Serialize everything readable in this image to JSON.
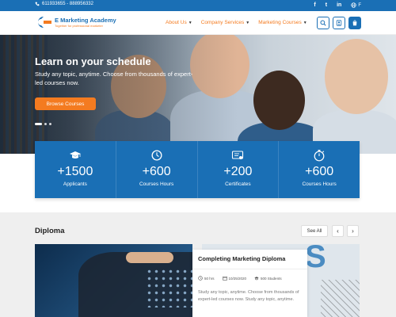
{
  "topbar": {
    "phone": "611933655 - 888956332",
    "socials": [
      {
        "icon": "facebook-icon",
        "glyph": "f"
      },
      {
        "icon": "twitter-icon",
        "glyph": "t"
      },
      {
        "icon": "linkedin-icon",
        "glyph": "in"
      }
    ],
    "lang_icon": "globe-icon",
    "lang_suffix": "F"
  },
  "header": {
    "logo_title": "E Marketing Academy",
    "logo_tagline": "Together for professional marketer",
    "nav": [
      {
        "label": "About Us"
      },
      {
        "label": "Company Services"
      },
      {
        "label": "Marketing Courses"
      }
    ],
    "icons": [
      "search-icon",
      "user-icon",
      "cart-icon"
    ]
  },
  "hero": {
    "title": "Learn on your schedule",
    "subtitle": "Study any topic, anytime. Choose from thousands of expert-led courses now.",
    "button": "Browse Courses",
    "slides": 3,
    "active_slide": 1
  },
  "stats": [
    {
      "icon": "graduation-cap-icon",
      "value": "+1500",
      "label": "Applicants"
    },
    {
      "icon": "clock-icon",
      "value": "+600",
      "label": "Courses Hours"
    },
    {
      "icon": "certificate-icon",
      "value": "+200",
      "label": "Certificates"
    },
    {
      "icon": "stopwatch-icon",
      "value": "+600",
      "label": "Courses Hours"
    }
  ],
  "diploma": {
    "title": "Diploma",
    "see_all": "See All",
    "card": {
      "title": "Completing Marketing Diploma",
      "hours": "50 hrs",
      "date": "10/25/2020",
      "students": "500 Students",
      "description": "Study any topic, anytime. Choose from thousands of expert-led courses now. Study any topic, anytime."
    }
  },
  "colors": {
    "primary": "#1a6fb5",
    "accent": "#f47b20",
    "section_bg": "#efefef"
  }
}
